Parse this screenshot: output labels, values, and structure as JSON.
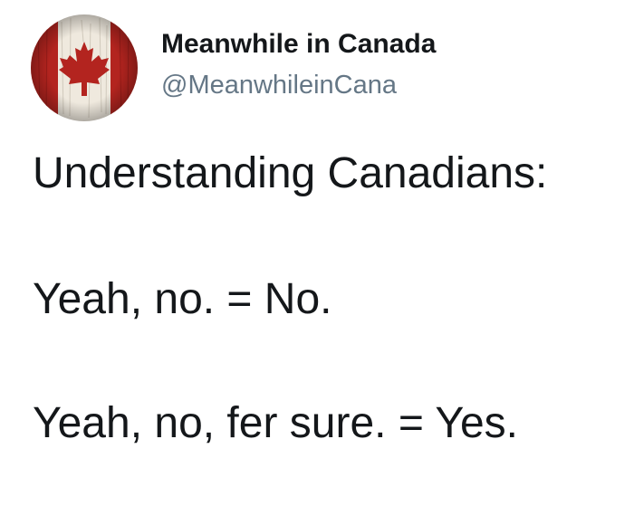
{
  "author": {
    "display_name": "Meanwhile in Canada",
    "handle": "@MeanwhileinCana",
    "avatar_icon": "canada-flag-avatar-icon"
  },
  "tweet": {
    "lines": [
      "Understanding Canadians:",
      "Yeah, no. = No.",
      "Yeah, no, fer sure. = Yes."
    ]
  },
  "colors": {
    "text": "#14171a",
    "handle": "#657786",
    "flag_red": "#b3241f",
    "flag_white": "#f2ede4"
  }
}
